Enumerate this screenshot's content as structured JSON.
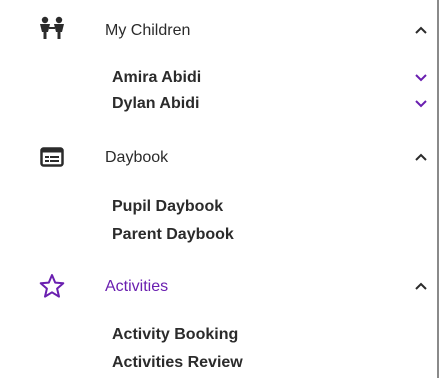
{
  "sections": [
    {
      "title": "My Children",
      "icon": "children-icon",
      "expanded": true,
      "items": [
        {
          "label": "Amira Abidi",
          "expandable": true
        },
        {
          "label": "Dylan Abidi",
          "expandable": true
        }
      ]
    },
    {
      "title": "Daybook",
      "icon": "daybook-icon",
      "expanded": true,
      "items": [
        {
          "label": "Pupil Daybook"
        },
        {
          "label": "Parent Daybook"
        }
      ]
    },
    {
      "title": "Activities",
      "icon": "star-icon",
      "expanded": true,
      "active": true,
      "items": [
        {
          "label": "Activity Booking"
        },
        {
          "label": "Activities Review"
        }
      ]
    }
  ],
  "colors": {
    "text": "#2b2b2b",
    "accent": "#6a1fb0"
  }
}
